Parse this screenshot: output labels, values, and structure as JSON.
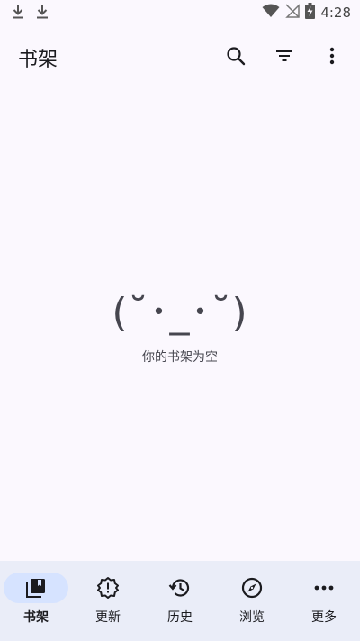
{
  "status_bar": {
    "time": "4:28",
    "icons": [
      "download-icon",
      "download-icon",
      "wifi-icon",
      "no-signal-icon",
      "battery-charging-icon"
    ]
  },
  "app_bar": {
    "title": "书架",
    "actions": [
      "search-icon",
      "filter-icon",
      "more-vert-icon"
    ]
  },
  "empty_state": {
    "kaomoji": "(˘･_･˘)",
    "message": "你的书架为空"
  },
  "bottom_nav": {
    "items": [
      {
        "label": "书架",
        "icon": "library-icon",
        "active": true
      },
      {
        "label": "更新",
        "icon": "update-alert-icon",
        "active": false
      },
      {
        "label": "历史",
        "icon": "history-icon",
        "active": false
      },
      {
        "label": "浏览",
        "icon": "compass-icon",
        "active": false
      },
      {
        "label": "更多",
        "icon": "more-horiz-icon",
        "active": false
      }
    ]
  },
  "colors": {
    "background": "#fbf8fe",
    "nav_background": "#eaedf8",
    "active_indicator": "#d6e3ff",
    "text": "#1b1b1f"
  }
}
